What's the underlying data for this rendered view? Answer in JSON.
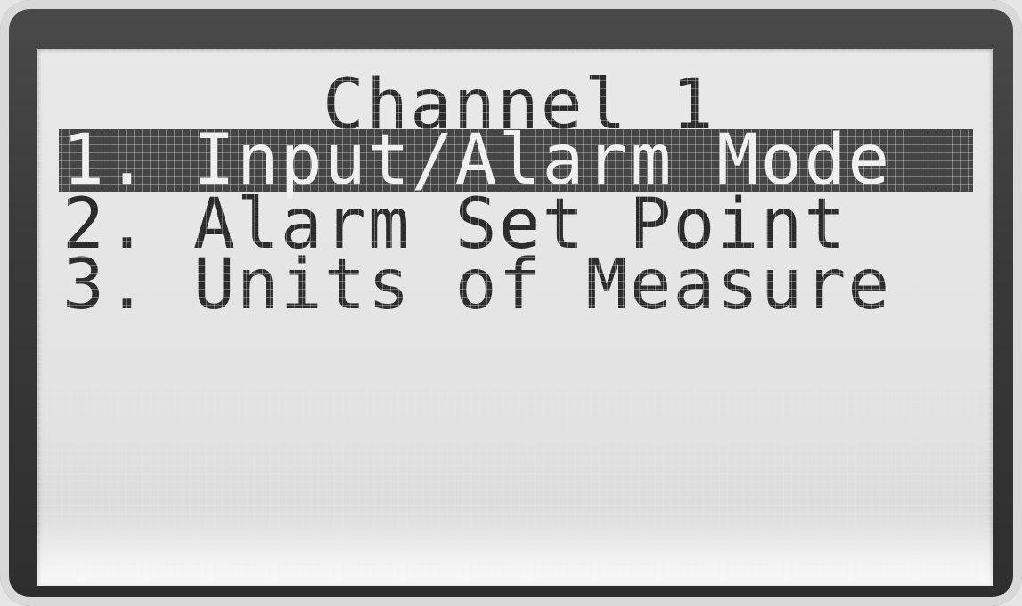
{
  "screen": {
    "title": "Channel 1",
    "menu": [
      {
        "label": "1. Input/Alarm Mode",
        "selected": true
      },
      {
        "label": "2. Alarm Set Point",
        "selected": false
      },
      {
        "label": "3. Units of Measure",
        "selected": false
      }
    ]
  }
}
